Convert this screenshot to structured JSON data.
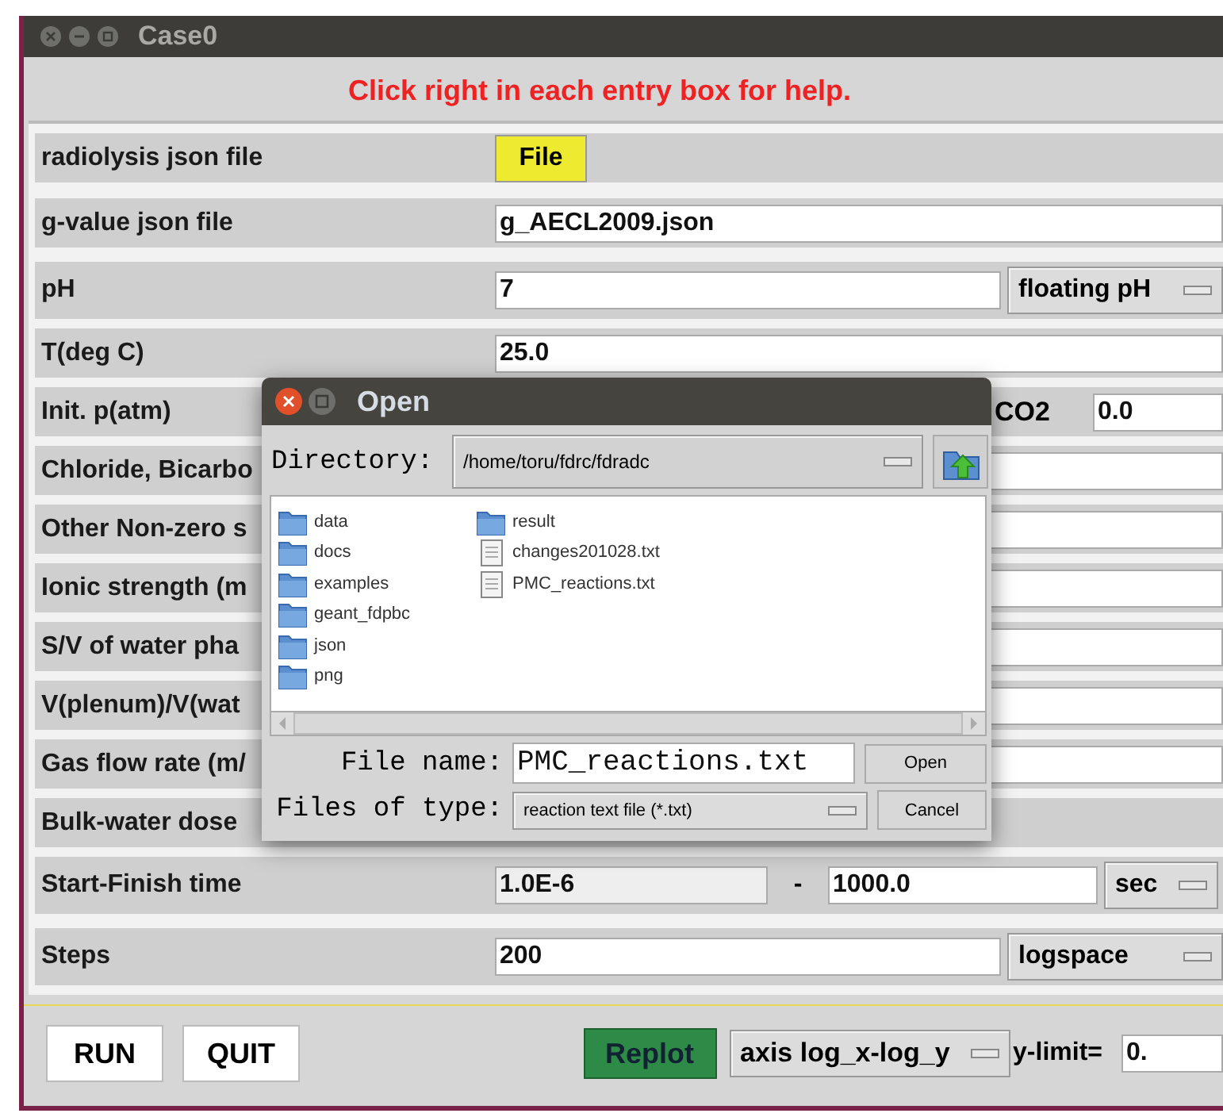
{
  "window": {
    "title": "Case0"
  },
  "help_text": "Click right in each entry box for help.",
  "rows": [
    {
      "kind": "button",
      "label": "radiolysis json file",
      "button": "File"
    },
    {
      "kind": "field",
      "label": "g-value json file",
      "value": "g_AECL2009.json"
    },
    {
      "kind": "field_menu",
      "label": "pH",
      "value": "7",
      "menu": "floating pH"
    },
    {
      "kind": "field",
      "label": "T(deg C)",
      "value": "25.0"
    },
    {
      "kind": "pair",
      "label": "Init. p(atm)",
      "label_2": "CO2",
      "value_2": "0.0"
    },
    {
      "kind": "field",
      "label": "Chloride, Bicarbo"
    },
    {
      "kind": "field",
      "label": "Other Non-zero s"
    },
    {
      "kind": "field",
      "label": "Ionic strength (m"
    },
    {
      "kind": "field",
      "label": "S/V of water pha"
    },
    {
      "kind": "field",
      "label": "V(plenum)/V(wat"
    },
    {
      "kind": "field",
      "label": "Gas flow rate (m/"
    },
    {
      "kind": "none",
      "label": "Bulk-water dose"
    },
    {
      "kind": "range",
      "label": "Start-Finish time",
      "value": "1.0E-6",
      "separator": "-",
      "value_2": "1000.0",
      "menu": "sec"
    },
    {
      "kind": "field_menu",
      "label": "Steps",
      "value": "200",
      "menu": "logspace"
    }
  ],
  "bottom_bar": {
    "run": "RUN",
    "quit": "QUIT",
    "replot": "Replot",
    "axis_menu": "axis log_x-log_y",
    "ylimit_label": "y-limit=",
    "ylimit_value": "0."
  },
  "dialog": {
    "title": "Open",
    "directory_label": "Directory:",
    "directory": "/home/toru/fdrc/fdradc",
    "files": [
      {
        "name": "data",
        "kind": "folder"
      },
      {
        "name": "docs",
        "kind": "folder"
      },
      {
        "name": "examples",
        "kind": "folder"
      },
      {
        "name": "geant_fdpbc",
        "kind": "folder"
      },
      {
        "name": "json",
        "kind": "folder"
      },
      {
        "name": "png",
        "kind": "folder"
      },
      {
        "name": "result",
        "kind": "folder"
      },
      {
        "name": "changes201028.txt",
        "kind": "file"
      },
      {
        "name": "PMC_reactions.txt",
        "kind": "file"
      }
    ],
    "file_name_label": "File name:",
    "file_name": "PMC_reactions.txt",
    "file_type_label": "Files of type:",
    "file_type": "reaction text file (*.txt)",
    "open": "Open",
    "cancel": "Cancel"
  }
}
